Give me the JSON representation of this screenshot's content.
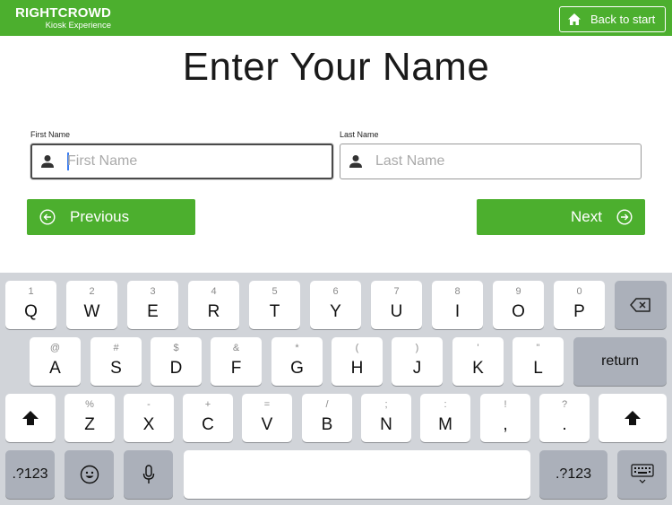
{
  "header": {
    "logo_main": "RIGHTCROWD",
    "logo_sub": "Kiosk Experience",
    "back_label": "Back to start",
    "brand_color": "#4caf2e"
  },
  "page": {
    "title": "Enter Your Name"
  },
  "form": {
    "first_name": {
      "label": "First Name",
      "placeholder": "First Name",
      "value": ""
    },
    "last_name": {
      "label": "Last Name",
      "placeholder": "Last Name",
      "value": ""
    }
  },
  "nav": {
    "previous_label": "Previous",
    "next_label": "Next"
  },
  "keyboard": {
    "row1": [
      {
        "main": "Q",
        "sub": "1"
      },
      {
        "main": "W",
        "sub": "2"
      },
      {
        "main": "E",
        "sub": "3"
      },
      {
        "main": "R",
        "sub": "4"
      },
      {
        "main": "T",
        "sub": "5"
      },
      {
        "main": "Y",
        "sub": "6"
      },
      {
        "main": "U",
        "sub": "7"
      },
      {
        "main": "I",
        "sub": "8"
      },
      {
        "main": "O",
        "sub": "9"
      },
      {
        "main": "P",
        "sub": "0"
      }
    ],
    "row2": [
      {
        "main": "A",
        "sub": "@"
      },
      {
        "main": "S",
        "sub": "#"
      },
      {
        "main": "D",
        "sub": "$"
      },
      {
        "main": "F",
        "sub": "&"
      },
      {
        "main": "G",
        "sub": "*"
      },
      {
        "main": "H",
        "sub": "("
      },
      {
        "main": "J",
        "sub": ")"
      },
      {
        "main": "K",
        "sub": "'"
      },
      {
        "main": "L",
        "sub": "\""
      }
    ],
    "row3": [
      {
        "main": "Z",
        "sub": "%"
      },
      {
        "main": "X",
        "sub": "-"
      },
      {
        "main": "C",
        "sub": "+"
      },
      {
        "main": "V",
        "sub": "="
      },
      {
        "main": "B",
        "sub": "/"
      },
      {
        "main": "N",
        "sub": ";"
      },
      {
        "main": "M",
        "sub": ":"
      },
      {
        "main": ",",
        "sub": "!"
      },
      {
        "main": ".",
        "sub": "?"
      }
    ],
    "return_label": "return",
    "numbers_label": ".?123"
  }
}
